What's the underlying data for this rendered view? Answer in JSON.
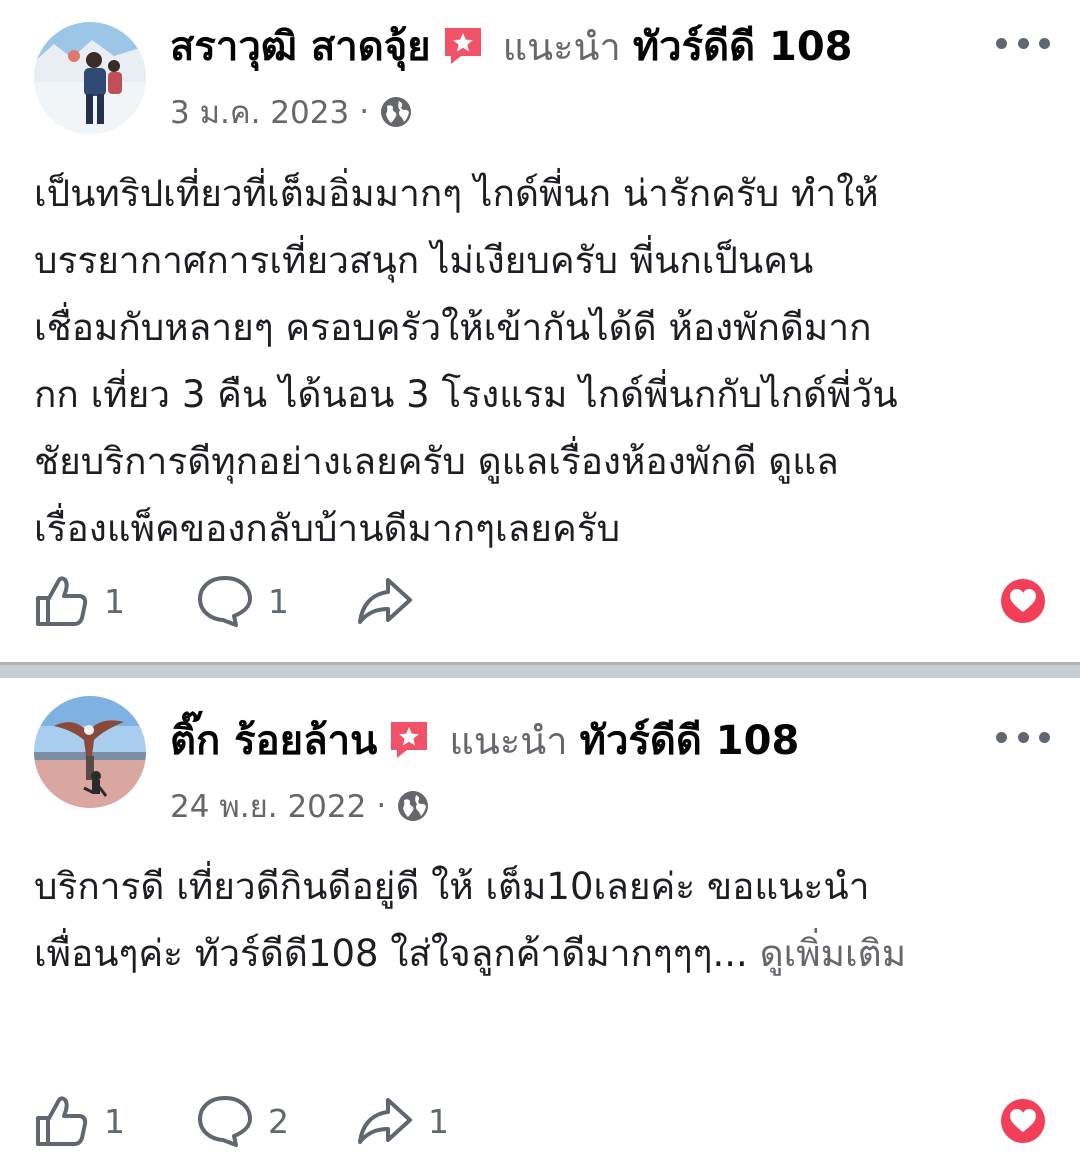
{
  "colors": {
    "name": "#050505",
    "secondary": "#65676b",
    "icon": "#606770",
    "heart": "#f33e58",
    "badge": "#f25268",
    "divider": "#c9ccd1"
  },
  "posts": [
    {
      "author": "สราวุฒิ สาดจุ้ย",
      "recommends_label": "แนะนำ",
      "page_name": "ทัวร์ดีดี 108",
      "date": "3 ม.ค. 2023",
      "separator": "·",
      "privacy_icon": "globe-icon",
      "lines": [
        "เป็นทริปเที่ยวที่เต็มอิ่มมากๆ ไกด์พี่นก น่ารักครับ ทำให้",
        "บรรยากาศการเที่ยวสนุก ไม่เงียบครับ พี่นกเป็นคน",
        "เชื่อมกับหลายๆ ครอบครัวให้เข้ากันได้ดี ห้องพักดีมาก",
        "กก เที่ยว 3 คืน ได้นอน 3 โรงแรม ไกด์พี่นกกับไกด์พี่วัน",
        "ชัยบริการดีทุกอย่างเลยครับ ดูแลเรื่องห้องพักดี ดูแล",
        "เรื่องแพ็คของกลับบ้านดีมากๆเลยครับ"
      ],
      "likes": "1",
      "comments": "1",
      "shares": ""
    },
    {
      "author": "ติ๊ก ร้อยล้าน",
      "recommends_label": "แนะนำ",
      "page_name": "ทัวร์ดีดี 108",
      "date": "24 พ.ย. 2022",
      "separator": "·",
      "privacy_icon": "globe-icon",
      "lines": [
        "บริการดี เที่ยวดีกินดีอยู่ดี ให้ เต็ม10เลยค่ะ  ขอแนะนำ",
        "เพื่อนๆค่ะ  ทัวร์ดีดี108 ใส่ใจลูกค้าดีมากๆๆๆ..."
      ],
      "see_more": "ดูเพิ่มเติม",
      "likes": "1",
      "comments": "2",
      "shares": "1"
    }
  ]
}
